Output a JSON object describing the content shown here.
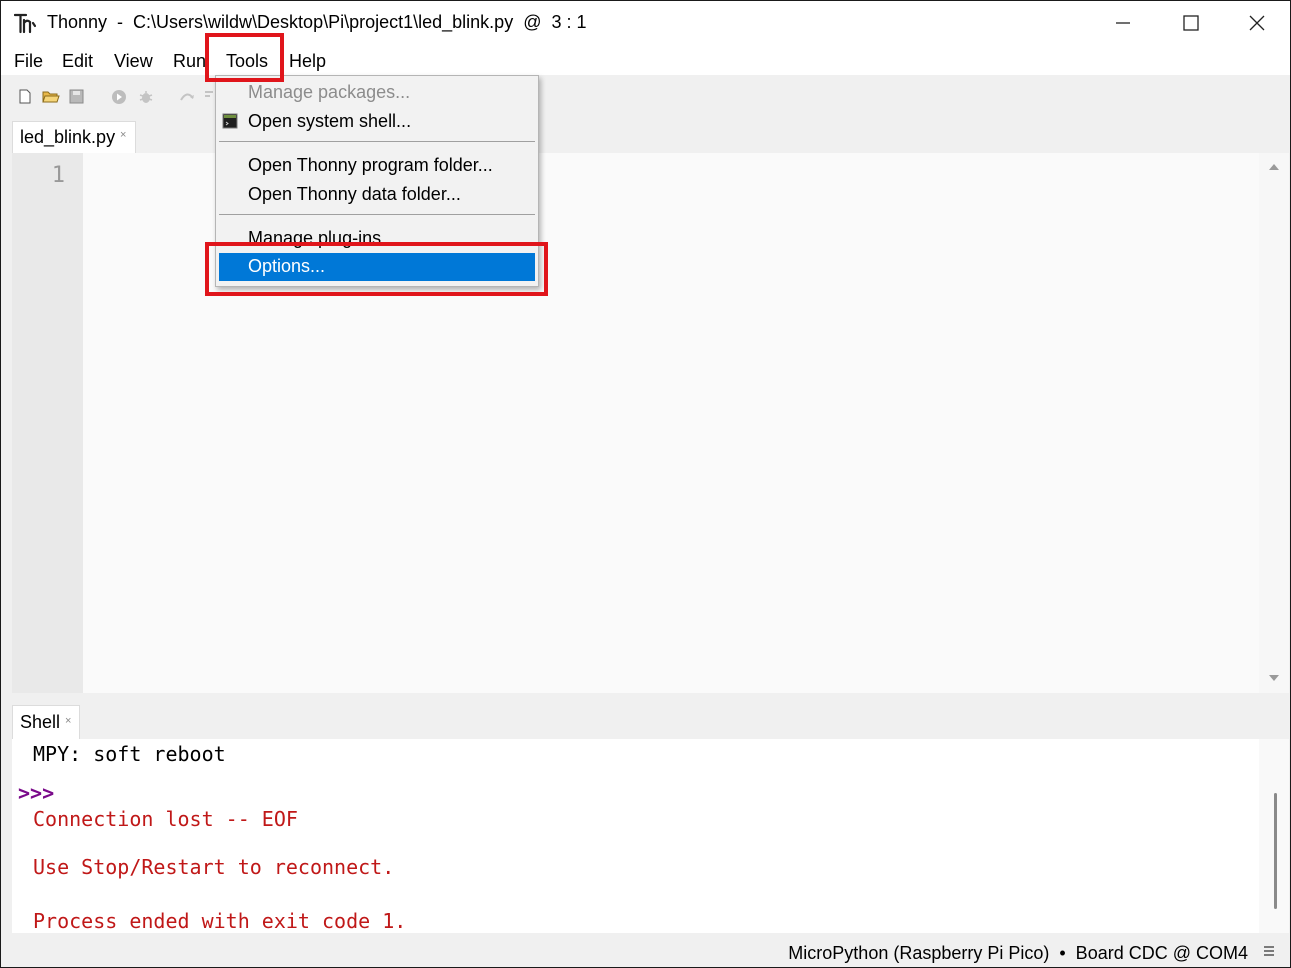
{
  "window": {
    "app_name": "Thonny",
    "title": "Thonny  -  C:\\Users\\wildw\\Desktop\\Pi\\project1\\led_blink.py  @  3 : 1"
  },
  "menubar": {
    "items": [
      {
        "label": "File"
      },
      {
        "label": "Edit"
      },
      {
        "label": "View"
      },
      {
        "label": "Run"
      },
      {
        "label": "Tools"
      },
      {
        "label": "Help"
      }
    ]
  },
  "toolbar": {
    "icons": [
      "new-file-icon",
      "open-folder-icon",
      "save-icon",
      "run-icon",
      "debug-icon",
      "step-over-icon",
      "step-into-icon"
    ]
  },
  "editor": {
    "tab_label": "led_blink.py",
    "tab_close": "×",
    "line_numbers": [
      "1"
    ]
  },
  "tools_menu": {
    "items": [
      {
        "label": "Manage packages...",
        "state": "disabled"
      },
      {
        "label": "Open system shell...",
        "icon": "terminal-icon"
      },
      {
        "label": "Open Thonny program folder..."
      },
      {
        "label": "Open Thonny data folder..."
      },
      {
        "label": "Manage plug-ins..."
      },
      {
        "label": "Options...",
        "state": "highlighted"
      }
    ]
  },
  "shell": {
    "tab_label": "Shell",
    "tab_close": "×",
    "lines": {
      "soft_reboot": "MPY: soft reboot",
      "prompt": ">>>",
      "connection_lost": "Connection lost -- EOF",
      "use_stop": "Use Stop/Restart to reconnect.",
      "process_ended": "Process ended with exit code 1."
    }
  },
  "statusbar": {
    "text": "MicroPython (Raspberry Pi Pico)  •  Board CDC @ COM4"
  },
  "colors": {
    "highlight_blue": "#0078d7",
    "annotation_red": "#e0151b",
    "shell_error": "#c01818",
    "shell_prompt": "#7a0a8a"
  }
}
